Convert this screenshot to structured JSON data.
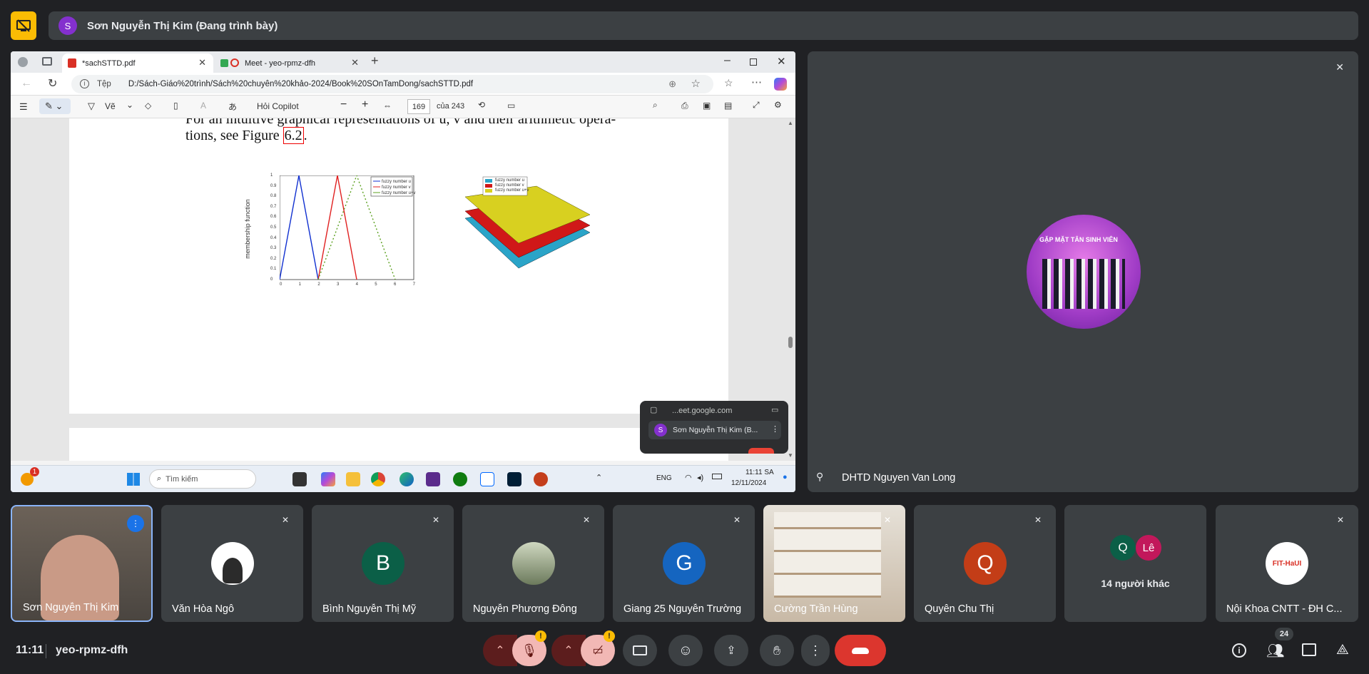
{
  "presenter": {
    "initial": "S",
    "name": "Sơn Nguyễn Thị Kim (Đang trình bày)"
  },
  "browser": {
    "tabs": [
      {
        "label": "*sachSTTD.pdf"
      },
      {
        "label": "Meet - yeo-rpmz-dfh"
      }
    ],
    "url_prefix": "Tệp",
    "url": "D:/Sách-Giáo%20trình/Sách%20chuyên%20khảo-2024/Book%20SOnTamDong/sachSTTD.pdf",
    "toolbar": {
      "draw": "Vẽ",
      "copilot": "Hỏi Copilot",
      "page": "169",
      "of": "của 243"
    }
  },
  "pdf": {
    "line1": "For an intuitive graphical representations of u, v and their arithmetic opera-",
    "line2": "tions, see Figure",
    "ref": "6.2",
    "period": ".",
    "ylabel": "membership function",
    "legend2d": [
      "fuzzy number u",
      "fuzzy number v",
      "fuzzy number u+v"
    ],
    "legend3d": [
      "fuzzy number u",
      "fuzzy number v",
      "fuzzy number u+v"
    ],
    "xticks": [
      "0",
      "1",
      "2",
      "3",
      "4",
      "5",
      "6",
      "7"
    ],
    "yticks": [
      "1",
      "0.9",
      "0.8",
      "0.7",
      "0.6",
      "0.5",
      "0.4",
      "0.3",
      "0.2",
      "0.1",
      "0"
    ]
  },
  "taskbar": {
    "search": "Tìm kiếm",
    "lang": "ENG",
    "time": "11:11 SA",
    "date": "12/11/2024",
    "badge": "1"
  },
  "popup": {
    "domain": "...eet.google.com",
    "name": "Sơn Nguyễn Thị Kim (B..."
  },
  "big_tile": {
    "name": "DHTD Nguyen Van Long",
    "banner": "GẶP MẶT TÂN SINH VIÊN"
  },
  "participants": [
    {
      "name": "Sơn Nguyễn Thị Kim"
    },
    {
      "name": "Văn Hòa Ngô"
    },
    {
      "name": "Bình Nguyễn Thị Mỹ",
      "initial": "B"
    },
    {
      "name": "Nguyễn Phương Đông"
    },
    {
      "name": "Giang 25 Nguyễn Trường",
      "initial": "G"
    },
    {
      "name": "Cường Trần Hùng"
    },
    {
      "name": "Quyên Chu Thị",
      "initial": "Q"
    },
    {
      "name": "14 người khác",
      "initial1": "Q",
      "initial2": "Lê"
    },
    {
      "name": "Nội Khoa CNTT - ĐH C...",
      "logo": "FIT-HaUI"
    }
  ],
  "bottom": {
    "time": "11:11",
    "code": "yeo-rpmz-dfh",
    "people_count": "24",
    "warn": "!"
  },
  "colors": {
    "bg": "#202124",
    "tile": "#3c4043",
    "accent": "#8ab4f8",
    "danger": "#ea4335",
    "yellow": "#fbbc04"
  }
}
